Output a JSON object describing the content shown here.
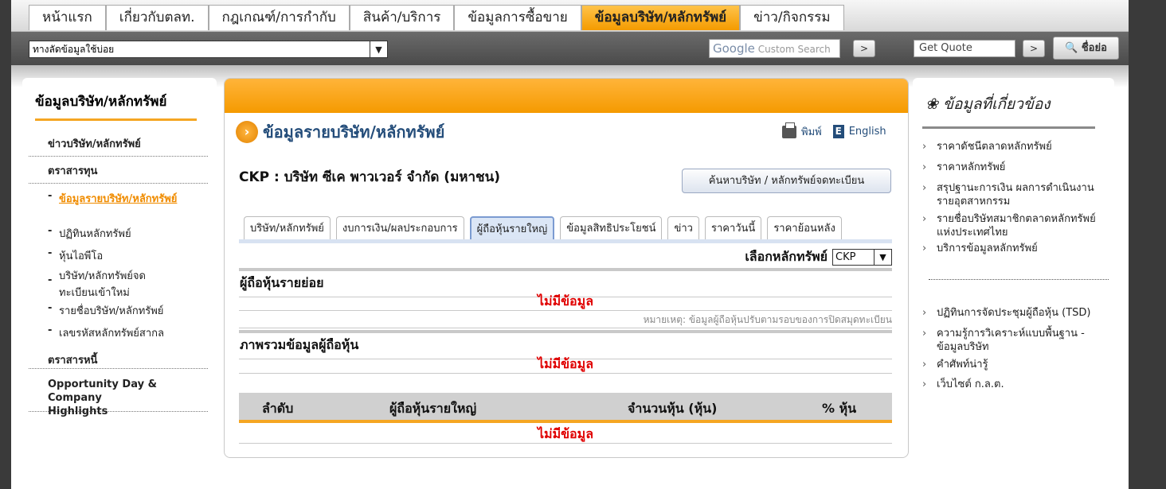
{
  "topnav": {
    "items": [
      "หน้าแรก",
      "เกี่ยวกับตลท.",
      "กฎเกณฑ์/การกำกับ",
      "สินค้า/บริการ",
      "ข้อมูลการซื้อขาย",
      "ข้อมูลบริษัท/หลักทรัพย์",
      "ข่าว/กิจกรรม"
    ],
    "active_index": 5
  },
  "toolbar": {
    "shortcut_value": "ทางลัดข้อมูลใช้บ่อย",
    "google_brand": "Google",
    "google_placeholder": "Custom Search",
    "quote_placeholder": "Get Quote",
    "go_glyph": ">",
    "name_button": "ชื่อย่อ"
  },
  "left": {
    "title": "ข้อมูลบริษัท/หลักทรัพย์",
    "news": "ข่าวบริษัท/หลักทรัพย์",
    "equity": "ตราสารทุน",
    "sub": [
      "ข้อมูลรายบริษัท/หลักทรัพย์",
      "ปฏิทินหลักทรัพย์",
      "หุ้นไอพีโอ",
      "บริษัท/หลักทรัพย์จดทะเบียนเข้าใหม่",
      "รายชื่อบริษัท/หลักทรัพย์",
      "เลขรหัสหลักทรัพย์สากล"
    ],
    "debt": "ตราสารหนี้",
    "opportunity": "Opportunity Day & Company Highlights"
  },
  "main": {
    "title": "ข้อมูลรายบริษัท/หลักทรัพย์",
    "print": "พิมพ์",
    "english": "English",
    "company": "CKP : บริษัท ซีเค พาวเวอร์ จำกัด (มหาชน)",
    "find_button": "ค้นหาบริษัท / หลักทรัพย์จดทะเบียน",
    "tabs": [
      "บริษัท/หลักทรัพย์",
      "งบการเงิน/ผลประกอบการ",
      "ผู้ถือหุ้นรายใหญ่",
      "ข้อมูลสิทธิประโยชน์",
      "ข่าว",
      "ราคาวันนี้",
      "ราคาย้อนหลัง"
    ],
    "active_tab": 2,
    "select_label": "เลือกหลักทรัพย์",
    "select_value": "CKP",
    "retail_title": "ผู้ถือหุ้นรายย่อย",
    "no_data": "ไม่มีข้อมูล",
    "note": "หมายเหตุ: ข้อมูลผู้ถือหุ้นปรับตามรอบของการปิดสมุดทะเบียน",
    "overview_title": "ภาพรวมข้อมูลผู้ถือหุ้น",
    "columns": [
      "ลำดับ",
      "ผู้ถือหุ้นรายใหญ่",
      "จำนวนหุ้น (หุ้น)",
      "% หุ้น"
    ]
  },
  "right": {
    "title": "ข้อมูลที่เกี่ยวข้อง",
    "links_top": [
      "ราคาดัชนีตลาดหลักทรัพย์",
      "ราคาหลักทรัพย์",
      "สรุปฐานะการเงิน ผลการดำเนินงาน รายอุตสาหกรรม",
      "รายชื่อบริษัทสมาชิกตลาดหลักทรัพย์แห่งประเทศไทย",
      "บริการข้อมูลหลักทรัพย์"
    ],
    "links_bottom": [
      "ปฏิทินการจัดประชุมผู้ถือหุ้น (TSD)",
      "ความรู้การวิเคราะห์แบบพื้นฐาน - ข้อมูลบริษัท",
      "คำศัพท์น่ารู้",
      "เว็บไซต์ ก.ล.ต."
    ]
  },
  "colors": {
    "accent": "#f5a623",
    "title_blue": "#244d7a",
    "nodata_red": "#e00000"
  }
}
